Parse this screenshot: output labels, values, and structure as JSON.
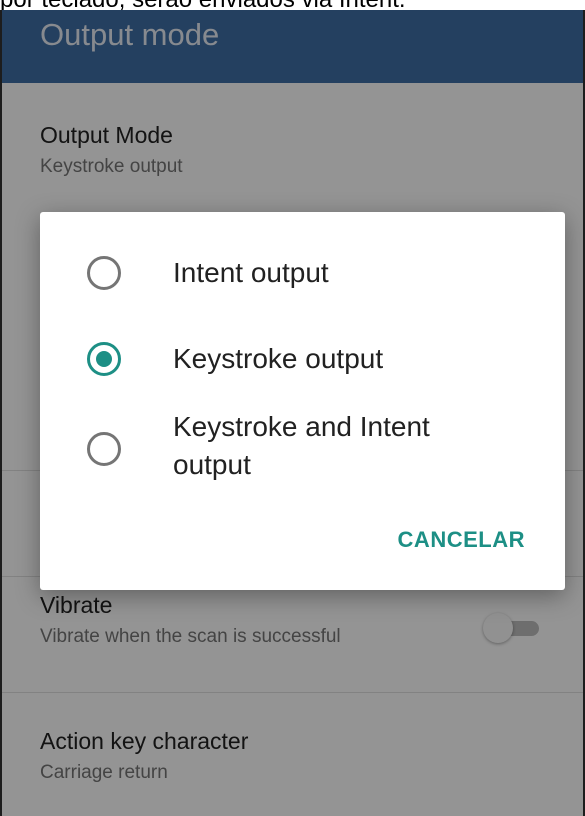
{
  "caption": "por teclado, serão enviados via Intent.",
  "appbar": {
    "title": "Output mode"
  },
  "preferences": [
    {
      "title": "Output Mode",
      "summary": "Keystroke output"
    },
    {
      "title": "Vibrate",
      "summary": "Vibrate when the scan is successful",
      "switch_on": false
    },
    {
      "title": "Action key character",
      "summary": "Carriage return"
    }
  ],
  "dialog": {
    "options": [
      {
        "label": "Intent output",
        "selected": false
      },
      {
        "label": "Keystroke output",
        "selected": true
      },
      {
        "label": "Keystroke and Intent output",
        "selected": false
      }
    ],
    "cancel_label": "CANCELAR"
  },
  "colors": {
    "appbar": "#3f6fa6",
    "accent": "#1d8f85",
    "scrim": "rgba(0,0,0,0.42)"
  }
}
